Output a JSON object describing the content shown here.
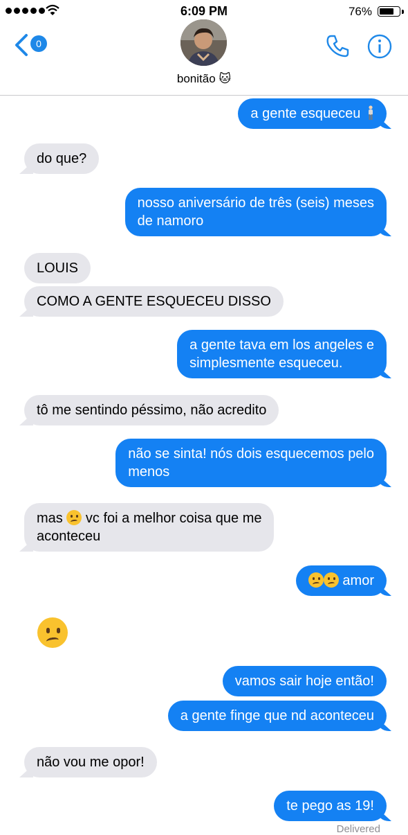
{
  "status_bar": {
    "time": "6:09 PM",
    "battery": "76%",
    "battery_level": 0.76,
    "signal_dots": 5
  },
  "header": {
    "back_badge": "0",
    "contact_name": "bonitão 🐱",
    "icons": [
      "back-chevron-icon",
      "avatar",
      "phone-icon",
      "info-icon"
    ]
  },
  "messages": [
    {
      "side": "out",
      "text": "a gente esqueceu",
      "suffix_icon": "person-standing-icon"
    },
    {
      "side": "in",
      "text": "do que?"
    },
    {
      "side": "out",
      "lines": [
        "nosso aniversário de três (seis) meses",
        "de namoro"
      ]
    },
    {
      "side": "in",
      "text": "LOUIS"
    },
    {
      "side": "in",
      "text": "COMO A GENTE ESQUECEU DISSO"
    },
    {
      "side": "out",
      "lines": [
        "a gente tava em los angeles e",
        "simplesmente esqueceu."
      ]
    },
    {
      "side": "in",
      "text": "tô me sentindo péssimo, não acredito"
    },
    {
      "side": "out",
      "lines": [
        "não se sinta! nós dois esquecemos pelo",
        "menos"
      ]
    },
    {
      "side": "in",
      "line1_prefix": "mas",
      "line1_suffix": "vc foi a melhor coisa que me",
      "line2": "aconteceu"
    },
    {
      "side": "out",
      "text": "amor",
      "prefix_icons": [
        "confused-face-emoji",
        "confused-face-emoji"
      ]
    },
    {
      "side": "in",
      "emoji_only": "confused-face-emoji"
    },
    {
      "side": "out",
      "text": "vamos sair hoje então!"
    },
    {
      "side": "out",
      "text": "a gente finge que nd aconteceu"
    },
    {
      "side": "in",
      "text": "não vou me opor!"
    },
    {
      "side": "out",
      "text": "te pego as 19!"
    }
  ],
  "delivered_label": "Delivered",
  "colors": {
    "accent": "#1481f3",
    "incoming_bubble": "#e6e6eb",
    "emoji": "#f9c22e"
  }
}
